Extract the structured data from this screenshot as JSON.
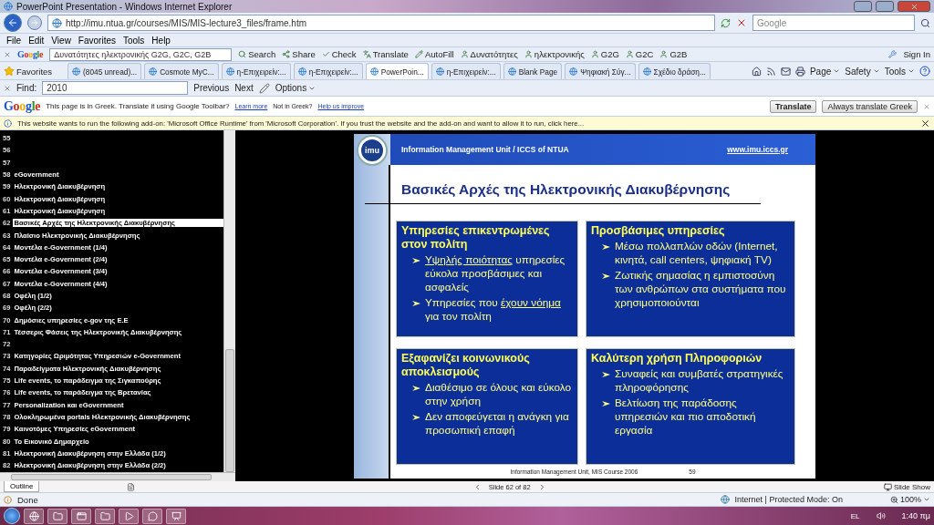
{
  "window": {
    "title": "PowerPoint Presentation - Windows Internet Explorer"
  },
  "address_bar": {
    "url": "http://imu.ntua.gr/courses/MIS/MIS-lecture3_files/frame.htm",
    "search_placeholder": "Google"
  },
  "menu": [
    "File",
    "Edit",
    "View",
    "Favorites",
    "Tools",
    "Help"
  ],
  "google_toolbar": {
    "logo": "Google",
    "query": "Δυνατότητες ηλεκτρονικής G2G, G2C, G2B",
    "buttons": [
      {
        "label": "Search",
        "kind": "search"
      },
      {
        "label": "Share",
        "kind": "share"
      },
      {
        "label": "Check",
        "kind": "check"
      },
      {
        "label": "Translate",
        "kind": "translate"
      },
      {
        "label": "AutoFill",
        "kind": "autofill"
      },
      {
        "label": "Δυνατότητες",
        "kind": "term"
      },
      {
        "label": "ηλεκτρονικής",
        "kind": "term"
      },
      {
        "label": "G2G",
        "kind": "term"
      },
      {
        "label": "G2C",
        "kind": "term"
      },
      {
        "label": "G2B",
        "kind": "term"
      }
    ],
    "sign_in": "Sign In"
  },
  "tabs_bar": {
    "favorites": "Favorites",
    "tabs": [
      {
        "label": "(8045 unread)...",
        "selected": false
      },
      {
        "label": "Cosmote MyC...",
        "selected": false
      },
      {
        "label": "η-Επιχειρείν:...",
        "selected": false
      },
      {
        "label": "η-Επιχειρείν:...",
        "selected": false
      },
      {
        "label": "PowerPoin...",
        "selected": true
      },
      {
        "label": "η-Επιχειρείν:...",
        "selected": false
      },
      {
        "label": "Blank Page",
        "selected": false
      },
      {
        "label": "Ψηφιακή Σύγ...",
        "selected": false
      },
      {
        "label": "Σχέδιο δράση...",
        "selected": false
      }
    ],
    "commands": [
      "Page",
      "Safety",
      "Tools"
    ]
  },
  "find_bar": {
    "label": "Find:",
    "value": "2010",
    "buttons": [
      "Previous",
      "Next"
    ],
    "options": "Options"
  },
  "translate_bar": {
    "logo": "Google",
    "message": "This page is in Greek.  Translate it using Google Toolbar?",
    "link": "Learn more",
    "note": "Not in Greek?",
    "help_link": "Help us improve",
    "buttons": [
      "Translate",
      "Always translate Greek"
    ]
  },
  "info_bar": {
    "message": "This website wants to run the following add-on: 'Microsoft Office Runtime' from 'Microsoft Corporation'. If you trust the website and the add-on and want to allow it to run, click here..."
  },
  "outline": {
    "slides": [
      {
        "number": "55",
        "selected": false
      },
      {
        "number": "56",
        "selected": false
      },
      {
        "number": "57",
        "selected": false
      },
      {
        "number": "58",
        "title": "eGovernment",
        "selected": false
      },
      {
        "number": "59",
        "title": "Ηλεκτρονική Διακυβέρνηση",
        "selected": false
      },
      {
        "number": "60",
        "title": "Ηλεκτρονική Διακυβέρνηση",
        "selected": false
      },
      {
        "number": "61",
        "title": "Ηλεκτρονική Διακυβέρνηση",
        "selected": false
      },
      {
        "number": "62",
        "title": "Βασικές Αρχές της Ηλεκτρονικής Διακυβέρνησης",
        "selected": true
      },
      {
        "number": "63",
        "title": "Πλαίσιο Ηλεκτρονικής Διακυβέρνησης",
        "selected": false
      },
      {
        "number": "64",
        "title": "Μοντέλα  e-Government (1/4)",
        "selected": false
      },
      {
        "number": "65",
        "title": "Μοντέλα  e-Government (2/4)",
        "selected": false
      },
      {
        "number": "66",
        "title": "Μοντέλα  e-Government (3/4)",
        "selected": false
      },
      {
        "number": "67",
        "title": "Μοντέλα  e-Government (4/4)",
        "selected": false
      },
      {
        "number": "68",
        "title": "Οφέλη (1/2)",
        "selected": false
      },
      {
        "number": "69",
        "title": "Οφέλη (2/2)",
        "selected": false
      },
      {
        "number": "70",
        "title": "Δημόσιες υπηρεσίες e-gov της Ε.Ε",
        "selected": false
      },
      {
        "number": "71",
        "title": "Τέσσερις Φάσεις της Ηλεκτρονικής Διακυβέρνησης",
        "selected": false
      },
      {
        "number": "72",
        "selected": false
      },
      {
        "number": "73",
        "title": "Κατηγορίες Ωριμότητας Υπηρεσιών e-Government",
        "selected": false
      },
      {
        "number": "74",
        "title": "Παραδείγματα Ηλεκτρονικής Διακυβέρνησης",
        "selected": false
      },
      {
        "number": "75",
        "title": "Life events, το παράδειγμα της Σιγκαπούρης",
        "selected": false
      },
      {
        "number": "76",
        "title": "Life events, το παράδειγμα της Βρετανίας",
        "selected": false
      },
      {
        "number": "77",
        "title": "Personalization και eGovernment",
        "selected": false
      },
      {
        "number": "78",
        "title": "Ολοκληρωμένα portals Ηλεκτρονικής Διακυβέρνησης",
        "selected": false
      },
      {
        "number": "79",
        "title": "Καινοτόμες Υπηρεσίες eGovernment",
        "selected": false
      },
      {
        "number": "80",
        "title": "Το Εικονικό Δημαρχείο",
        "selected": false
      },
      {
        "number": "81",
        "title": "Ηλεκτρονική Διακυβέρνηση στην Ελλάδα (1/2)",
        "selected": false
      },
      {
        "number": "82",
        "title": "Ηλεκτρονική Διακυβέρνηση στην Ελλάδα (2/2)",
        "selected": false
      }
    ]
  },
  "slide": {
    "logo": "imu",
    "header": "Information Management Unit / ICCS of NTUA",
    "website": "www.imu.iccs.gr",
    "title": "Βασικές Αρχές της Ηλεκτρονικής Διακυβέρνησης",
    "boxes": [
      {
        "heading": "Υπηρεσίες επικεντρωμένες στον πολίτη",
        "bullets": [
          [
            {
              "text": "Υψηλής ποιότητας",
              "underlined": true
            },
            {
              "text": " υπηρεσίες εύκολα προσβάσιμες και ασφαλείς",
              "underlined": false
            }
          ],
          [
            {
              "text": "Υπηρεσίες που ",
              "underlined": false
            },
            {
              "text": "έχουν νόημα",
              "underlined": true
            },
            {
              "text": " για τον πολίτη",
              "underlined": false
            }
          ]
        ]
      },
      {
        "heading": "Προσβάσιμες υπηρεσίες",
        "bullets": [
          [
            {
              "text": "Μέσω πολλαπλών οδών (Internet, κινητά, call centers, ψηφιακή TV)",
              "underlined": false
            }
          ],
          [
            {
              "text": "Ζωτικής σημασίας η εμπιστοσύνη των ανθρώπων στα συστήματα που χρησιμοποιούνται",
              "underlined": false
            }
          ]
        ]
      },
      {
        "heading": "Εξαφανίζει κοινωνικούς αποκλεισμούς",
        "bullets": [
          [
            {
              "text": "Διαθέσιμο σε όλους και εύκολο στην χρήση",
              "underlined": false
            }
          ],
          [
            {
              "text": "Δεν αποφεύγεται η ανάγκη για προσωπική επαφή",
              "underlined": false
            }
          ]
        ]
      },
      {
        "heading": "Καλύτερη χρήση Πληροφοριών",
        "bullets": [
          [
            {
              "text": "Συναφείς και συμβατές στρατηγικές πληροφόρησης",
              "underlined": false
            }
          ],
          [
            {
              "text": "Βελτίωση της παράδοσης υπηρεσιών και πιο αποδοτική εργασία",
              "underlined": false
            }
          ]
        ]
      }
    ],
    "footer": "Information Management Unit, MIS Course 2006",
    "page": "59"
  },
  "viewer_bar": {
    "tab": "Outline",
    "counter": "Slide 62 of 82",
    "slide_show": "Slide Show"
  },
  "status_bar": {
    "text": "Done",
    "zone": "Internet | Protected Mode: On",
    "zoom": "100%"
  },
  "taskbar": {
    "language": "EL",
    "time": "1:40 πμ"
  }
}
